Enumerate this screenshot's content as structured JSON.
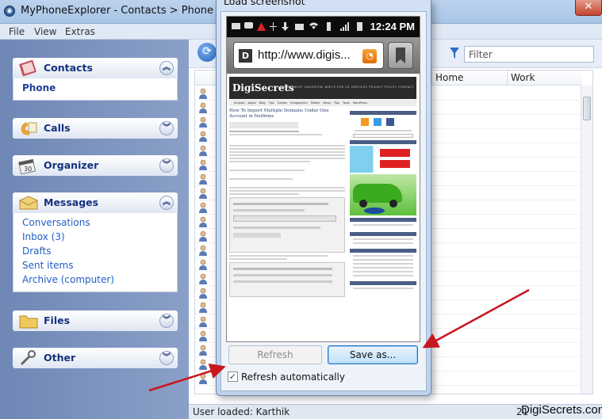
{
  "window": {
    "title": "MyPhoneExplorer - Contacts > Phone",
    "close_label": "✕"
  },
  "menu": [
    "File",
    "View",
    "Extras"
  ],
  "sidebar": {
    "contacts": {
      "label": "Contacts",
      "items": [
        "Phone"
      ]
    },
    "calls": {
      "label": "Calls"
    },
    "organizer": {
      "label": "Organizer"
    },
    "messages": {
      "label": "Messages",
      "items": [
        "Conversations",
        "Inbox (3)",
        "Drafts",
        "Sent items",
        "Archive (computer)"
      ]
    },
    "files": {
      "label": "Files"
    },
    "other": {
      "label": "Other"
    }
  },
  "toolbar": {
    "filter_placeholder": "Filter"
  },
  "grid": {
    "columns": [
      "Home",
      "Work"
    ]
  },
  "status": {
    "user": "User loaded: Karthik",
    "count": "21"
  },
  "watermark": "DigiSecrets.com",
  "dialog": {
    "title": "Load screenshot",
    "refresh_label": "Refresh",
    "save_label": "Save as...",
    "auto_refresh_label": "Refresh automatically",
    "auto_refresh_checked": "✓"
  },
  "phone": {
    "time": "12:24 PM",
    "url": "http://www.digis...",
    "favicon": "D",
    "site": {
      "logo": "DigiSecrets",
      "top_nav": "HOME  ABOUT  ADVERTISE  WRITE FOR US  SERVICES  PRIVACY POLICY  CONTACT",
      "categories": "Android Apple Blog Tips Games Infographics Mobile News Tips Tools WordPress",
      "article_title": "How To Import Multiple Domains Under One Account in Netfirms"
    }
  },
  "colors": {
    "accent": "#1e3f9a",
    "link": "#215dc6",
    "arrow": "#c8161d"
  }
}
